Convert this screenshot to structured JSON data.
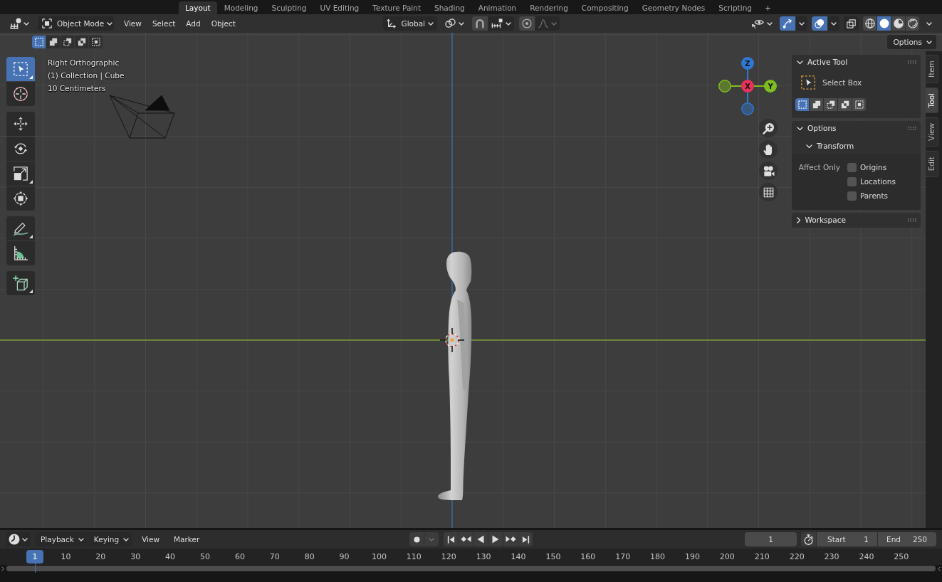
{
  "workspace_tabs": [
    {
      "label": "Layout",
      "selected": true
    },
    {
      "label": "Modeling",
      "selected": false
    },
    {
      "label": "Sculpting",
      "selected": false
    },
    {
      "label": "UV Editing",
      "selected": false
    },
    {
      "label": "Texture Paint",
      "selected": false
    },
    {
      "label": "Shading",
      "selected": false
    },
    {
      "label": "Animation",
      "selected": false
    },
    {
      "label": "Rendering",
      "selected": false
    },
    {
      "label": "Compositing",
      "selected": false
    },
    {
      "label": "Geometry Nodes",
      "selected": false
    },
    {
      "label": "Scripting",
      "selected": false
    }
  ],
  "add_workspace": "+",
  "header": {
    "mode": "Object Mode",
    "menus": [
      "View",
      "Select",
      "Add",
      "Object"
    ],
    "orientation": "Global",
    "snap": {
      "on": false
    },
    "proportional_editing": {
      "on": false
    },
    "gizmos": {
      "on": true
    },
    "overlays": {
      "on": true
    },
    "xray": {
      "on": false
    },
    "shading_modes": [
      {
        "kind": "wireframe",
        "selected": false
      },
      {
        "kind": "solid",
        "selected": true
      },
      {
        "kind": "material",
        "selected": false
      },
      {
        "kind": "rendered",
        "selected": false
      }
    ]
  },
  "tool_settings": {
    "selection_modes": [
      {
        "kind": "set",
        "selected": true
      },
      {
        "kind": "extend",
        "selected": false
      },
      {
        "kind": "subtract",
        "selected": false
      },
      {
        "kind": "difference",
        "selected": false
      },
      {
        "kind": "intersect",
        "selected": false
      }
    ],
    "options": "Options"
  },
  "viewport": {
    "view_name": "Right Orthographic",
    "object_info": "(1) Collection | Cube",
    "grid_scale": "10 Centimeters",
    "toolbar": [
      {
        "tools": [
          {
            "kind": "select_box",
            "selected": true,
            "submenu": true
          },
          {
            "kind": "cursor",
            "selected": false,
            "submenu": false
          }
        ]
      },
      {
        "tools": [
          {
            "kind": "move",
            "selected": false,
            "submenu": false
          },
          {
            "kind": "rotate",
            "selected": false,
            "submenu": false
          },
          {
            "kind": "scale",
            "selected": false,
            "submenu": true
          },
          {
            "kind": "transform",
            "selected": false,
            "submenu": false
          }
        ]
      },
      {
        "tools": [
          {
            "kind": "annotate",
            "selected": false,
            "submenu": true
          },
          {
            "kind": "measure",
            "selected": false,
            "submenu": false
          }
        ]
      },
      {
        "tools": [
          {
            "kind": "add_cube",
            "selected": false,
            "submenu": true
          }
        ]
      }
    ],
    "gizmo_axes": [
      {
        "label": "Z",
        "kind": "vertical",
        "color": "#2f78d2"
      },
      {
        "label": "Y",
        "kind": "horizontal",
        "color": "#7fbe1f"
      },
      {
        "label": "X",
        "kind": "depth",
        "color": "#e8325a"
      }
    ]
  },
  "sidebar": {
    "tabs": [
      {
        "label": "Item",
        "selected": false
      },
      {
        "label": "Tool",
        "selected": true
      },
      {
        "label": "View",
        "selected": false
      },
      {
        "label": "Edit",
        "selected": false
      }
    ],
    "panels": [
      {
        "kind": "active_tool",
        "title": "Active Tool",
        "expanded": true,
        "tool_name": "Select Box",
        "modes": [
          {
            "kind": "set",
            "selected": true
          },
          {
            "kind": "extend",
            "selected": false
          },
          {
            "kind": "subtract",
            "selected": false
          },
          {
            "kind": "difference",
            "selected": false
          },
          {
            "kind": "intersect",
            "selected": false
          }
        ]
      },
      {
        "kind": "options",
        "title": "Options",
        "expanded": true,
        "subpanels": [
          {
            "title": "Transform",
            "expanded": true,
            "field_label": "Affect Only",
            "checkboxes": [
              {
                "label": "Origins",
                "checked": false
              },
              {
                "label": "Locations",
                "checked": false
              },
              {
                "label": "Parents",
                "checked": false
              }
            ]
          }
        ]
      },
      {
        "title": "Workspace",
        "expanded": false
      }
    ]
  },
  "timeline": {
    "menus": [
      {
        "label": "Playback",
        "kind": "dropdown"
      },
      {
        "label": "Keying",
        "kind": "dropdown"
      },
      {
        "label": "View",
        "kind": "menu"
      },
      {
        "label": "Marker",
        "kind": "menu"
      }
    ],
    "auto_keying": {
      "on": false
    },
    "current_frame": "1",
    "start": {
      "label": "Start",
      "value": "1"
    },
    "end": {
      "label": "End",
      "value": "250"
    },
    "playhead": "1",
    "frame_ticks": [
      "10",
      "20",
      "30",
      "40",
      "50",
      "60",
      "70",
      "80",
      "90",
      "100",
      "110",
      "120",
      "130",
      "140",
      "150",
      "160",
      "170",
      "180",
      "190",
      "200",
      "210",
      "220",
      "230",
      "240",
      "250"
    ]
  }
}
